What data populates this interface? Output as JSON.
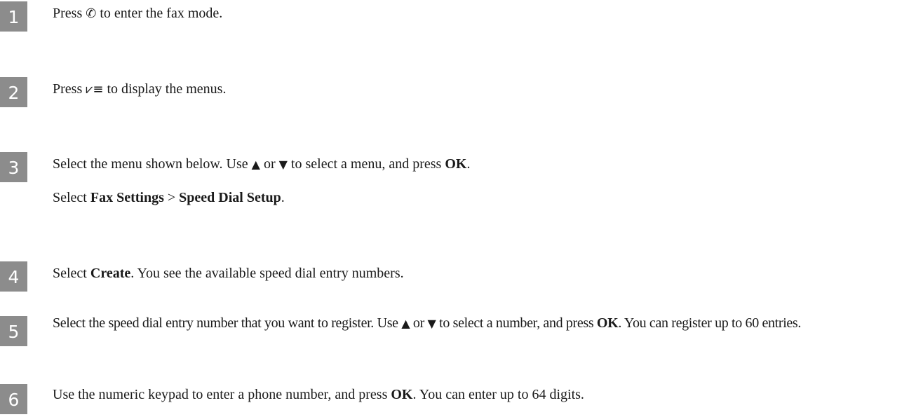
{
  "steps": [
    {
      "num": "1",
      "a": "Press ",
      "icon": "fax-mode-icon",
      "icon_glyph": "✆",
      "b": " to enter the fax mode."
    },
    {
      "num": "2",
      "a": "Press ",
      "icon": "menu-icon",
      "icon_glyph": "⩗≡",
      "b": " to display the menus."
    },
    {
      "num": "3",
      "a": "Select the menu shown below. Use ",
      "up": "▲",
      "or": " or ",
      "down": "▼",
      "b": " to select a menu, and press ",
      "ok": "OK",
      "c": ".",
      "sub_a": "Select ",
      "sub_b1": "Fax Settings",
      "sub_sep": " > ",
      "sub_b2": "Speed Dial Setup",
      "sub_end": "."
    },
    {
      "num": "4",
      "a": "Select ",
      "bold": "Create",
      "b": ". You see the available speed dial entry numbers."
    },
    {
      "num": "5",
      "a": "Select the speed dial entry number that you want to register. Use ",
      "up": "▲",
      "or": " or ",
      "down": "▼",
      "b": " to select a number, and press ",
      "ok": "OK",
      "c": ". You can register up to 60 entries."
    },
    {
      "num": "6",
      "a": "Use the numeric keypad to enter a phone number, and press ",
      "ok": "OK",
      "b": ". You can enter up to 64 digits."
    }
  ]
}
